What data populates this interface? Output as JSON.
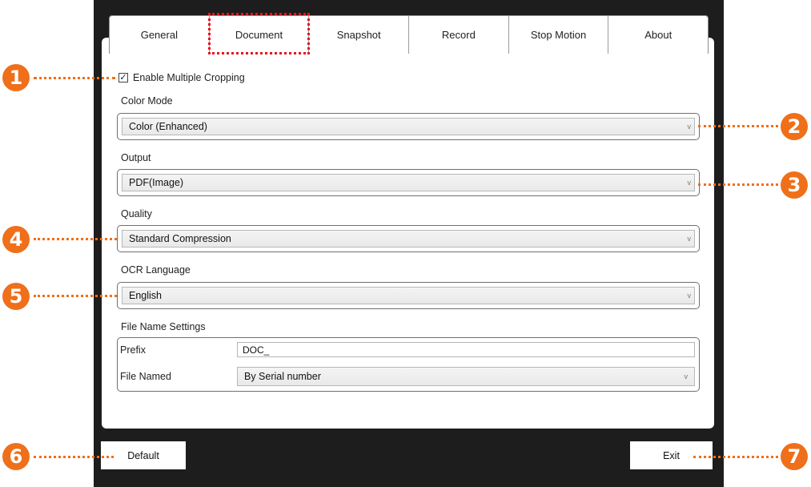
{
  "tabs": [
    "General",
    "Document",
    "Snapshot",
    "Record",
    "Stop Motion",
    "About"
  ],
  "selected_tab": "Document",
  "enable_multiple_cropping": {
    "label": "Enable Multiple Cropping",
    "checked": true,
    "mark": "✓"
  },
  "color_mode": {
    "label": "Color Mode",
    "value": "Color (Enhanced)"
  },
  "output": {
    "label": "Output",
    "value": "PDF(Image)"
  },
  "quality": {
    "label": "Quality",
    "value": "Standard Compression"
  },
  "ocr_language": {
    "label": "OCR Language",
    "value": "English"
  },
  "file_name_settings": {
    "label": "File Name Settings",
    "prefix_label": "Prefix",
    "prefix_value": "DOC_",
    "file_named_label": "File Named",
    "file_named_value": "By Serial number"
  },
  "buttons": {
    "default": "Default",
    "exit": "Exit"
  },
  "callouts": [
    "1",
    "2",
    "3",
    "4",
    "5",
    "6",
    "7"
  ],
  "colors": {
    "accent": "#ef6f1a",
    "selection": "#e8141c",
    "frame": "#1d1d1d"
  },
  "dropdown_arrow": "v"
}
